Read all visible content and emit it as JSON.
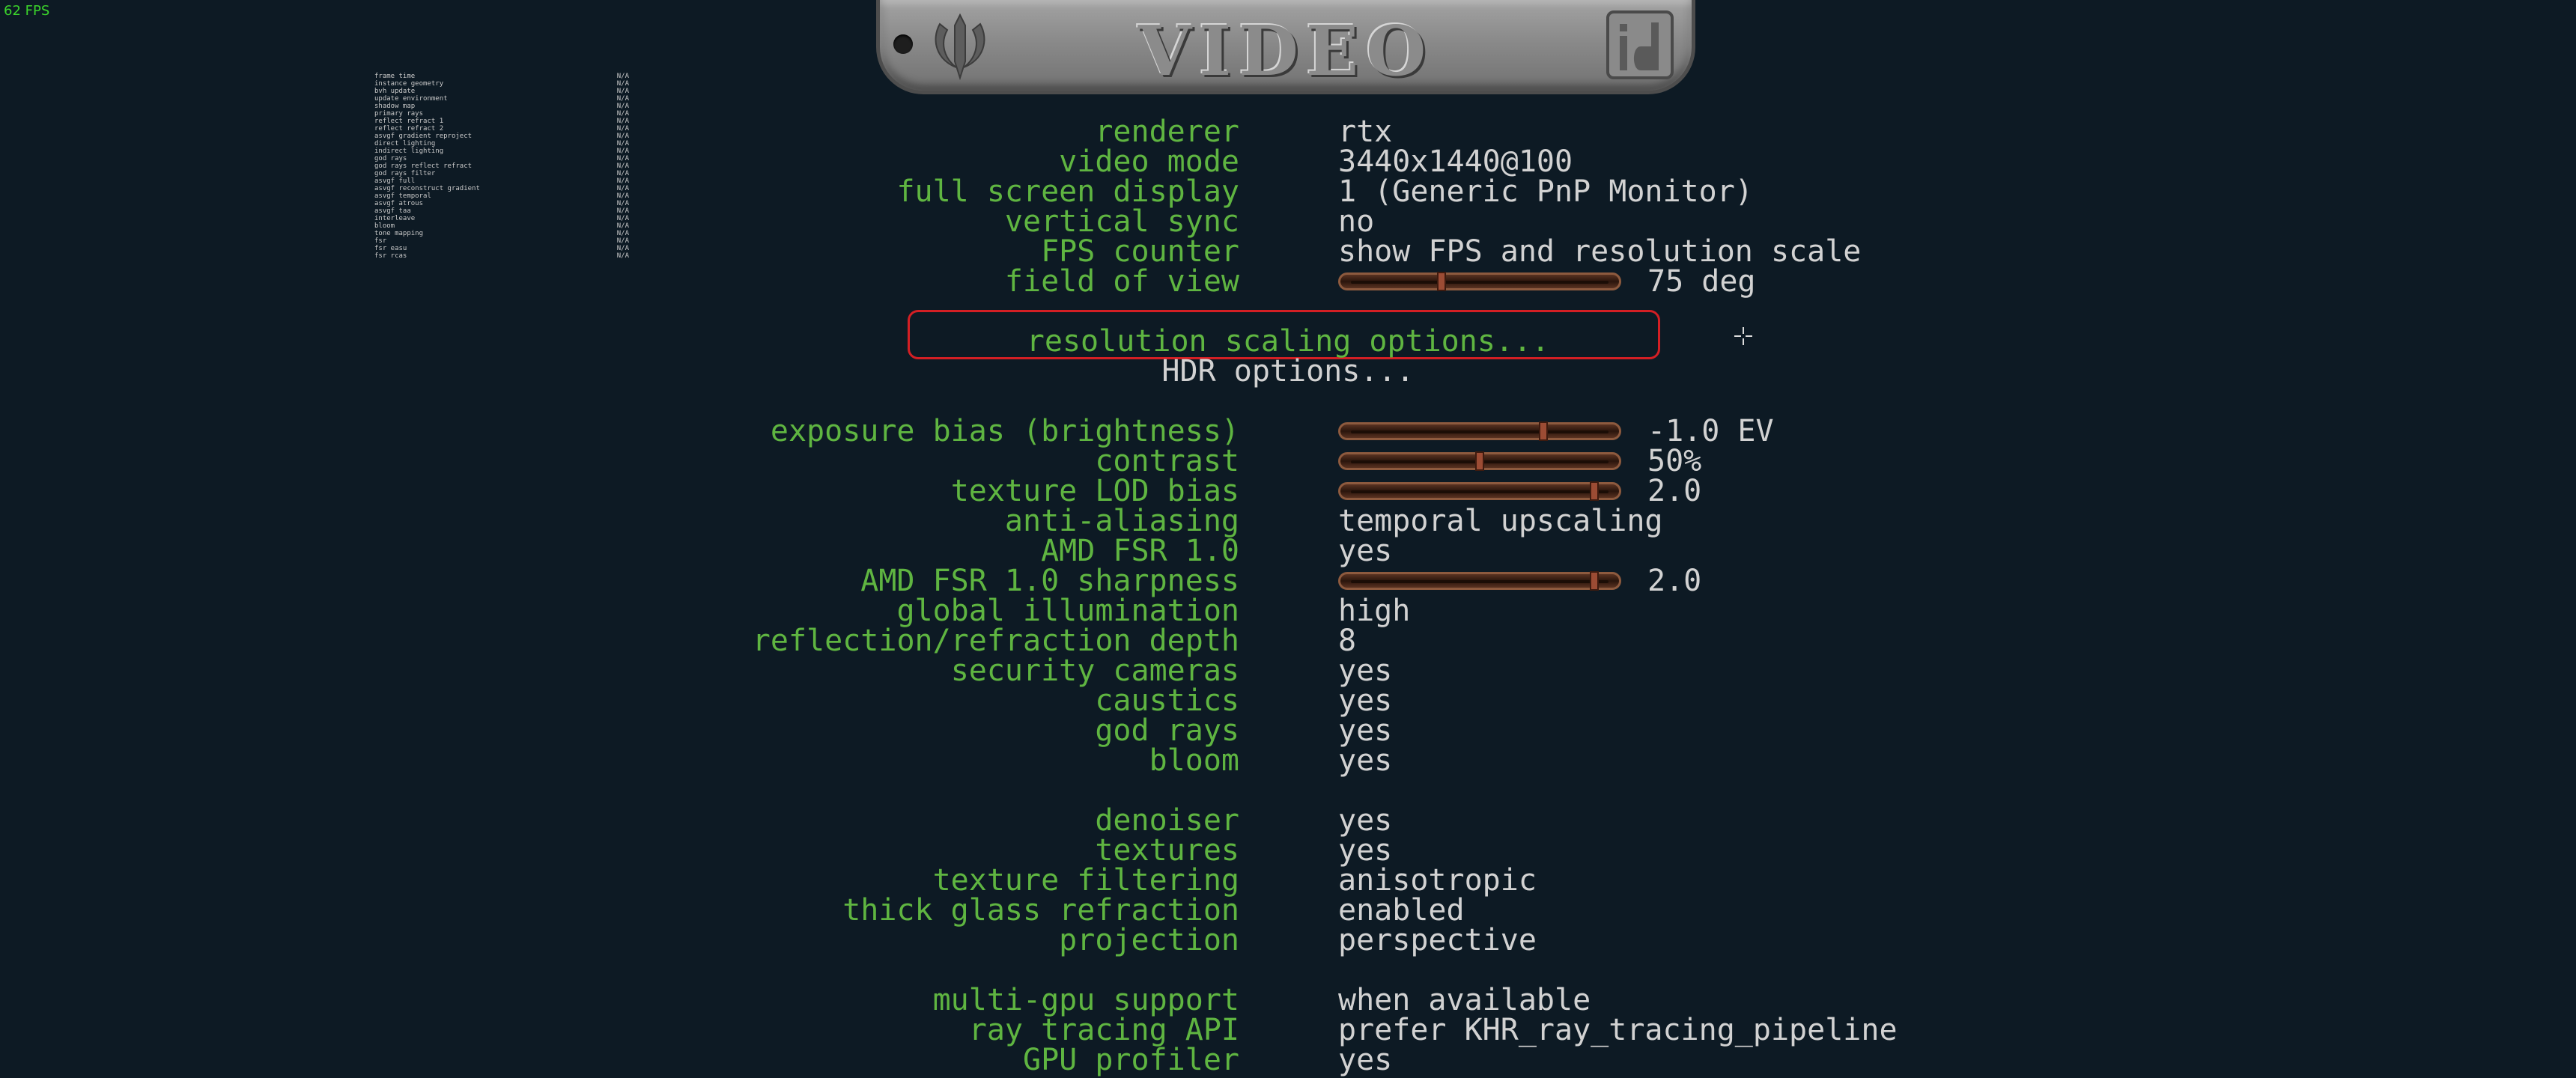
{
  "fps_counter": "62 FPS",
  "banner": {
    "title": "VIDEO"
  },
  "profiler": [
    {
      "name": "frame time",
      "value": "N/A"
    },
    {
      "name": "instance geometry",
      "value": "N/A"
    },
    {
      "name": "bvh update",
      "value": "N/A"
    },
    {
      "name": "update environment",
      "value": "N/A"
    },
    {
      "name": "shadow map",
      "value": "N/A"
    },
    {
      "name": "primary rays",
      "value": "N/A"
    },
    {
      "name": "reflect refract 1",
      "value": "N/A"
    },
    {
      "name": "reflect refract 2",
      "value": "N/A"
    },
    {
      "name": "asvgf gradient reproject",
      "value": "N/A"
    },
    {
      "name": "direct lighting",
      "value": "N/A"
    },
    {
      "name": "indirect lighting",
      "value": "N/A"
    },
    {
      "name": "god rays",
      "value": "N/A"
    },
    {
      "name": "god rays reflect refract",
      "value": "N/A"
    },
    {
      "name": "god rays filter",
      "value": "N/A"
    },
    {
      "name": "asvgf full",
      "value": "N/A"
    },
    {
      "name": "asvgf reconstruct gradient",
      "value": "N/A"
    },
    {
      "name": "asvgf temporal",
      "value": "N/A"
    },
    {
      "name": "asvgf atrous",
      "value": "N/A"
    },
    {
      "name": "asvgf taa",
      "value": "N/A"
    },
    {
      "name": "interleave",
      "value": "N/A"
    },
    {
      "name": "bloom",
      "value": "N/A"
    },
    {
      "name": "tone mapping",
      "value": "N/A"
    },
    {
      "name": "fsr",
      "value": "N/A"
    },
    {
      "name": "fsr easu",
      "value": "N/A"
    },
    {
      "name": "fsr rcas",
      "value": "N/A"
    }
  ],
  "menu": {
    "renderer": {
      "label": "renderer",
      "value": "rtx"
    },
    "video_mode": {
      "label": "video mode",
      "value": "3440x1440@100"
    },
    "full_screen": {
      "label": "full screen display",
      "value": "1 (Generic PnP Monitor)"
    },
    "vsync": {
      "label": "vertical sync",
      "value": "no"
    },
    "fps": {
      "label": "FPS counter",
      "value": "show FPS and resolution scale"
    },
    "fov": {
      "label": "field of view",
      "value": "75 deg",
      "level": 0.35
    },
    "res_scaling": {
      "label": "resolution scaling options..."
    },
    "hdr": {
      "label": "HDR options..."
    },
    "exposure": {
      "label": "exposure bias (brightness)",
      "value": "-1.0 EV",
      "level": 0.75
    },
    "contrast": {
      "label": "contrast",
      "value": "50%",
      "level": 0.5
    },
    "lod_bias": {
      "label": "texture LOD bias",
      "value": "2.0",
      "level": 0.95
    },
    "aa": {
      "label": "anti-aliasing",
      "value": "temporal upscaling"
    },
    "fsr": {
      "label": "AMD FSR 1.0",
      "value": "yes"
    },
    "fsr_sharp": {
      "label": "AMD FSR 1.0 sharpness",
      "value": "2.0",
      "level": 0.95
    },
    "gi": {
      "label": "global illumination",
      "value": "high"
    },
    "refl_depth": {
      "label": "reflection/refraction depth",
      "value": "8"
    },
    "cameras": {
      "label": "security cameras",
      "value": "yes"
    },
    "caustics": {
      "label": "caustics",
      "value": "yes"
    },
    "god_rays": {
      "label": "god rays",
      "value": "yes"
    },
    "bloom": {
      "label": "bloom",
      "value": "yes"
    },
    "denoiser": {
      "label": "denoiser",
      "value": "yes"
    },
    "textures": {
      "label": "textures",
      "value": "yes"
    },
    "tex_filter": {
      "label": "texture filtering",
      "value": "anisotropic"
    },
    "glass": {
      "label": "thick glass refraction",
      "value": "enabled"
    },
    "projection": {
      "label": "projection",
      "value": "perspective"
    },
    "multigpu": {
      "label": "multi-gpu support",
      "value": "when available"
    },
    "rt_api": {
      "label": "ray tracing API",
      "value": "prefer KHR_ray_tracing_pipeline"
    },
    "profiler": {
      "label": "GPU profiler",
      "value": "yes"
    }
  },
  "colors": {
    "label": "#5fb541",
    "value": "#d2d2d2",
    "selected_outline": "#d31f24",
    "background": "#0d1a24"
  }
}
